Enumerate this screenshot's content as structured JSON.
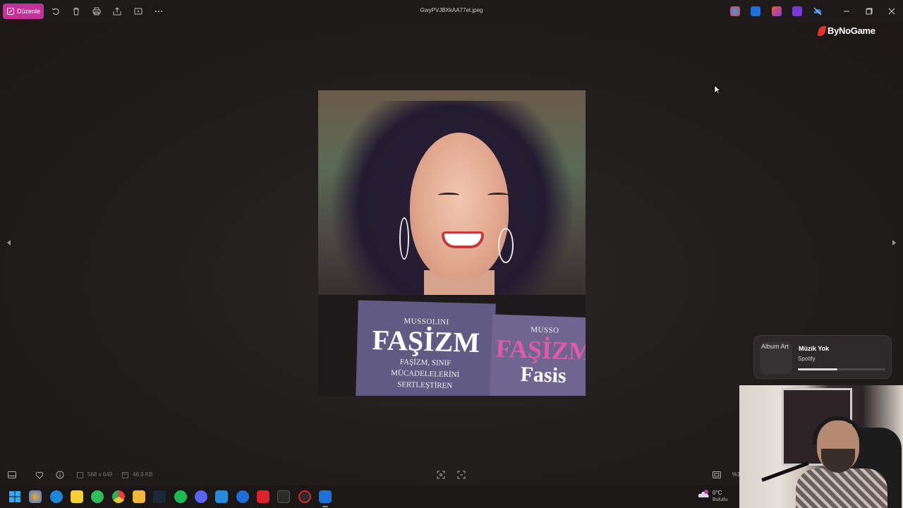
{
  "window": {
    "title": "GwyPVJBXkAA77et.jpeg",
    "edit_label": "Düzenle"
  },
  "brand": {
    "name": "ByNoGame"
  },
  "image": {
    "book_small": "MUSSOLINI",
    "book_title": "FAŞİZM",
    "book_sub_line1": "FAŞİZM, SINIF",
    "book_sub_line2": "MÜCADELELERİNİ",
    "book_sub_line3": "SERTLEŞTİREN",
    "book2_small": "MUSSO",
    "book2_title": "FAŞİZM",
    "book2_sub": "Fasis"
  },
  "info_bar": {
    "dimensions": "568 x 649",
    "file_size": "46.9 KB",
    "zoom": "%1"
  },
  "spotify_widget": {
    "album_art_alt": "Album Art",
    "title": "Müzik Yok",
    "source": "Spotify",
    "progress": 0.45
  },
  "weather": {
    "temp": "0°C",
    "desc": "Bulutlu"
  },
  "colors": {
    "accent": "#c2339a",
    "background": "#1f1a1a",
    "brand_red": "#e2332c"
  }
}
